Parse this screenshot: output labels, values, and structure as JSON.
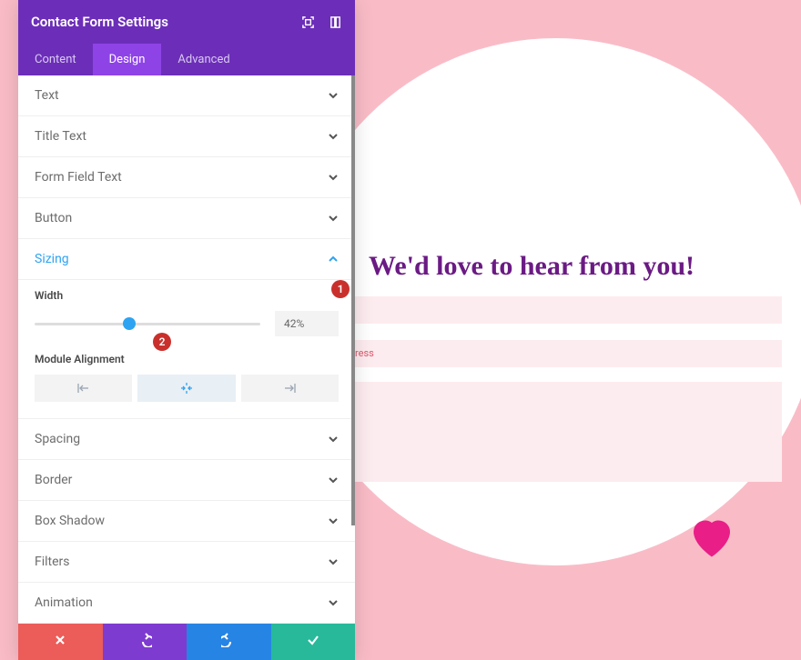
{
  "panel": {
    "title": "Contact Form Settings",
    "tabs": [
      {
        "label": "Content",
        "active": false
      },
      {
        "label": "Design",
        "active": true
      },
      {
        "label": "Advanced",
        "active": false
      }
    ],
    "sections": {
      "text": "Text",
      "title_text": "Title Text",
      "form_field": "Form Field Text",
      "button": "Button",
      "sizing": "Sizing",
      "spacing": "Spacing",
      "border": "Border",
      "box_shadow": "Box Shadow",
      "filters": "Filters",
      "animation": "Animation"
    },
    "sizing": {
      "width_label": "Width",
      "width_value": "42%",
      "width_percent": 42,
      "alignment_label": "Module Alignment",
      "alignment_selected": "center"
    }
  },
  "preview": {
    "heading": "We'd love to hear from you!",
    "field2_placeholder_fragment": "ress"
  },
  "badges": {
    "one": "1",
    "two": "2"
  },
  "colors": {
    "panel_header": "#6c2eb9",
    "tab_active": "#8e43e7",
    "accent_blue": "#2ea3f2",
    "badge_red": "#c9302c",
    "footer_cancel": "#ec5c59",
    "footer_undo": "#7e3bd0",
    "footer_redo": "#2684e5",
    "footer_save": "#27b99a",
    "bg": "#f9bcc7",
    "heart": "#e91e87",
    "preview_title": "#6b1a84",
    "form_field_bg": "#fdecef"
  }
}
